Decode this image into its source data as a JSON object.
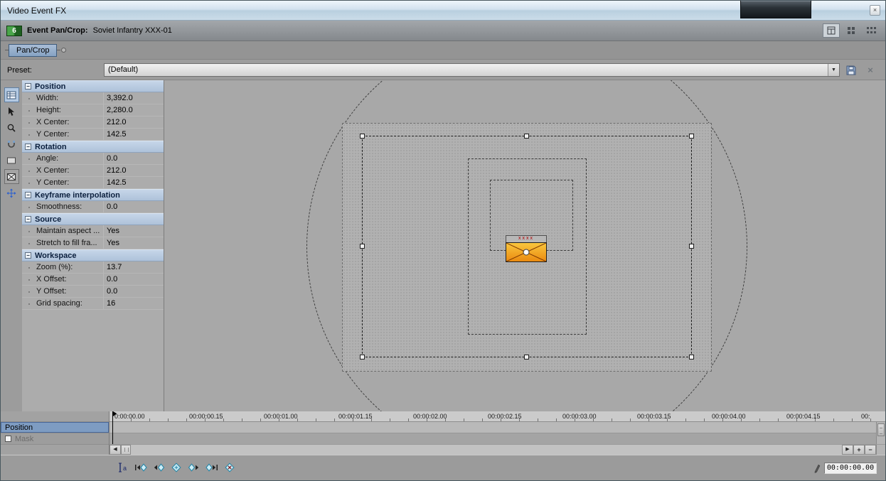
{
  "window": {
    "title": "Video Event FX",
    "close_glyph": "×"
  },
  "header": {
    "badge": "6",
    "title": "Event Pan/Crop:",
    "clip_name": "Soviet Infantry XXX-01"
  },
  "tab": {
    "label": "Pan/Crop"
  },
  "preset": {
    "label": "Preset:",
    "value": "(Default)",
    "dropdown_glyph": "▼",
    "delete_glyph": "×"
  },
  "properties": {
    "collapse_glyph": "−",
    "sections": [
      {
        "title": "Position",
        "rows": [
          {
            "label": "Width:",
            "value": "3,392.0"
          },
          {
            "label": "Height:",
            "value": "2,280.0"
          },
          {
            "label": "X Center:",
            "value": "212.0"
          },
          {
            "label": "Y Center:",
            "value": "142.5"
          }
        ]
      },
      {
        "title": "Rotation",
        "rows": [
          {
            "label": "Angle:",
            "value": "0.0"
          },
          {
            "label": "X Center:",
            "value": "212.0"
          },
          {
            "label": "Y Center:",
            "value": "142.5"
          }
        ]
      },
      {
        "title": "Keyframe interpolation",
        "rows": [
          {
            "label": "Smoothness:",
            "value": "0.0"
          }
        ]
      },
      {
        "title": "Source",
        "rows": [
          {
            "label": "Maintain aspect ...",
            "value": "Yes"
          },
          {
            "label": "Stretch to fill fra...",
            "value": "Yes"
          }
        ]
      },
      {
        "title": "Workspace",
        "rows": [
          {
            "label": "Zoom (%):",
            "value": "13.7"
          },
          {
            "label": "X Offset:",
            "value": "0.0"
          },
          {
            "label": "Y Offset:",
            "value": "0.0"
          },
          {
            "label": "Grid spacing:",
            "value": "16"
          }
        ]
      }
    ]
  },
  "workspace_view": {
    "media_marks": "xxxx"
  },
  "timeline": {
    "tracks": [
      {
        "label": "Position"
      },
      {
        "label": "Mask"
      }
    ],
    "ruler_labels": [
      "0:00:00.00",
      "00:00:00.15",
      "00:00:01.00",
      "00:00:01.15",
      "00:00:02.00",
      "00:00:02.15",
      "00:00:03.00",
      "00:00:03.15",
      "00:00:04.00",
      "00:00:04.15",
      "00:"
    ],
    "cursor_time": "00:00:00.00"
  },
  "icons": {
    "sync_cursor_letter": "a",
    "scrollbar": {
      "left": "◀",
      "right": "▶",
      "zoom_in": "+",
      "zoom_out": "−"
    }
  }
}
